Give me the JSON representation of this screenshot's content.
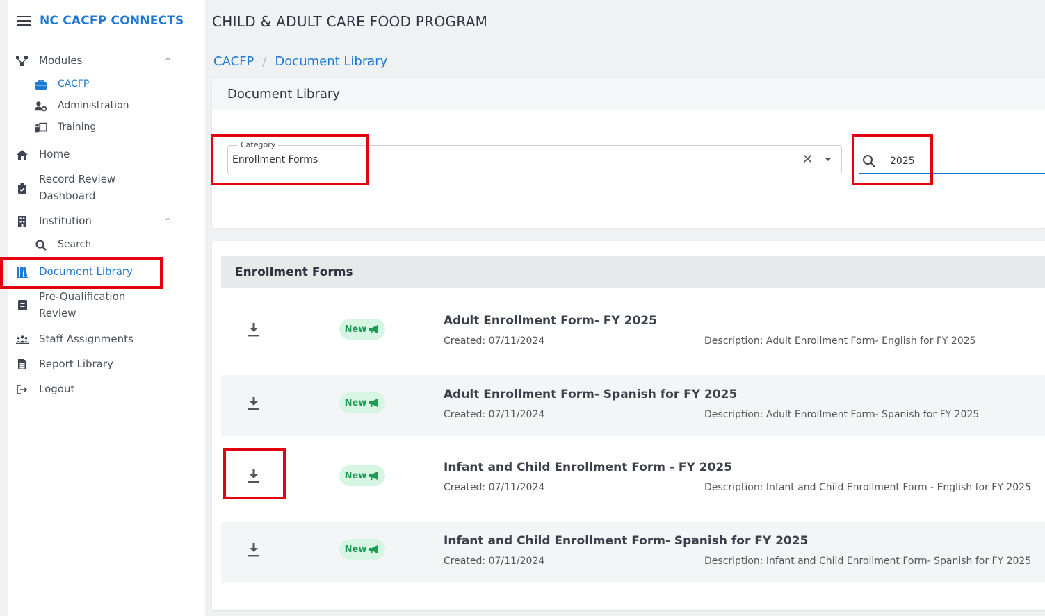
{
  "app": {
    "title": "NC CACFP CONNECTS",
    "page_header": "CHILD & ADULT CARE FOOD PROGRAM"
  },
  "sidebar": {
    "modules": {
      "label": "Modules",
      "chevron": "^"
    },
    "module_items": [
      {
        "label": "CACFP",
        "icon": "briefcase-icon"
      },
      {
        "label": "Administration",
        "icon": "users-cog-icon"
      },
      {
        "label": "Training",
        "icon": "chalkboard-teacher-icon"
      }
    ],
    "items": [
      {
        "label": "Home",
        "icon": "home-icon"
      },
      {
        "label": "Record Review Dashboard",
        "icon": "clipboard-check-icon"
      },
      {
        "label": "Institution",
        "icon": "building-icon"
      },
      {
        "label": "Document Library",
        "icon": "book-library-icon"
      },
      {
        "label": "Pre-Qualification Review",
        "icon": "address-book-icon"
      },
      {
        "label": "Staff Assignments",
        "icon": "people-group-icon"
      },
      {
        "label": "Report Library",
        "icon": "file-report-icon"
      },
      {
        "label": "Logout",
        "icon": "sign-out-icon"
      }
    ],
    "institution_sub": {
      "label": "Search",
      "icon": "search-icon"
    },
    "institution_chevron": "^",
    "record_review": {
      "line1": "Record Review",
      "line2": "Dashboard"
    },
    "prequal": {
      "line1": "Pre-Qualification",
      "line2": "Review"
    }
  },
  "breadcrumb": {
    "root": "CACFP",
    "separator": "/",
    "current": "Document Library"
  },
  "filter_card": {
    "title": "Document Library",
    "category": {
      "label": "Category",
      "value": "Enrollment Forms",
      "clear": "✕"
    },
    "search": {
      "value": "2025"
    }
  },
  "documents": {
    "section_title": "Enrollment Forms",
    "badge_label": "New",
    "rows": [
      {
        "name": "Adult Enrollment Form- FY 2025",
        "created": "Created: 07/11/2024",
        "description": "Description: Adult Enrollment Form- English for FY 2025"
      },
      {
        "name": "Adult Enrollment Form- Spanish for FY 2025",
        "created": "Created: 07/11/2024",
        "description": "Description: Adult Enrollment Form- Spanish for FY 2025"
      },
      {
        "name": "Infant and Child Enrollment Form - FY 2025",
        "created": "Created: 07/11/2024",
        "description": "Description: Infant and Child Enrollment Form - English for FY 2025"
      },
      {
        "name": "Infant and Child Enrollment Form- Spanish for FY 2025",
        "created": "Created: 07/11/2024",
        "description": "Description: Infant and Child Enrollment Form- Spanish for FY 2025"
      }
    ]
  },
  "colors": {
    "accent": "#1f78d1",
    "highlight": "#e3000f",
    "badge_bg": "#d6f5e3",
    "badge_text": "#1f9a55"
  }
}
